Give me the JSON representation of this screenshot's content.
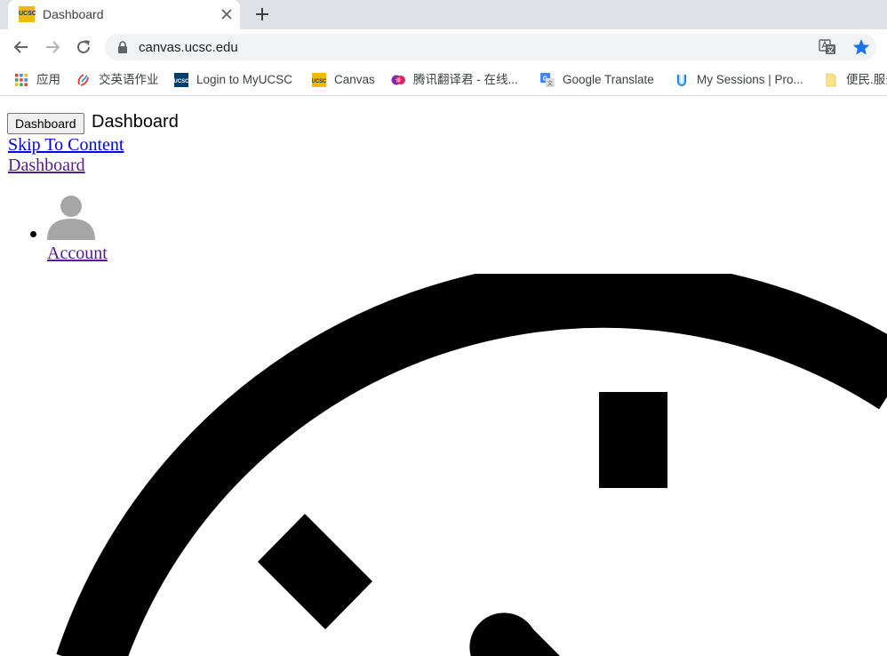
{
  "browser": {
    "tab": {
      "title": "Dashboard",
      "favicon_text": "UCSC"
    },
    "url": "canvas.ucsc.edu",
    "accent_color": "#1a73e8"
  },
  "bookmarks": [
    {
      "label": "应用",
      "icon": "apps-grid-icon"
    },
    {
      "label": "交英语作业",
      "icon": "pencil-logo-icon"
    },
    {
      "label": "Login to MyUCSC",
      "icon": "ucsc-logo-icon"
    },
    {
      "label": "Canvas",
      "icon": "ucsc-gold-logo-icon"
    },
    {
      "label": "腾讯翻译君 - 在线...",
      "icon": "tencent-translate-icon"
    },
    {
      "label": "Google Translate",
      "icon": "google-translate-icon"
    },
    {
      "label": "My Sessions | Pro...",
      "icon": "sessions-logo-icon"
    },
    {
      "label": "便民.服务",
      "icon": "folder-icon"
    }
  ],
  "page": {
    "dashboard_button": "Dashboard",
    "dashboard_text": "Dashboard",
    "skip_link": "Skip To Content",
    "dashboard_link": "Dashboard",
    "account_link": "Account"
  }
}
